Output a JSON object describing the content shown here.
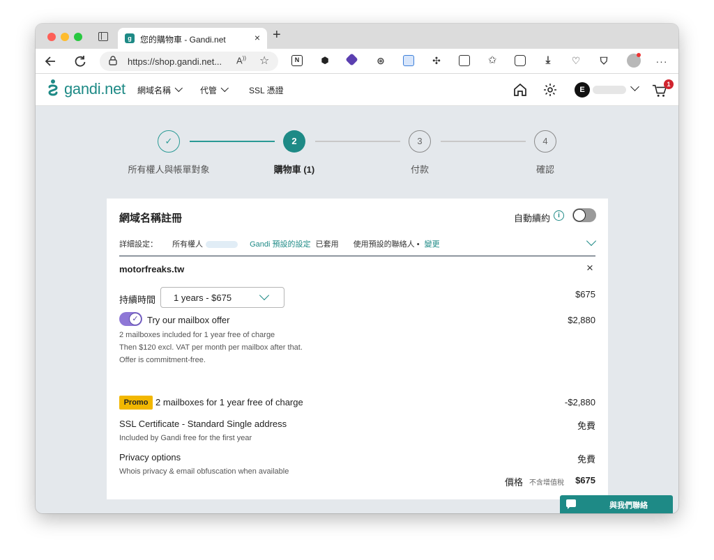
{
  "browser": {
    "tab_title": "您的購物車 - Gandi.net",
    "url": "https://shop.gandi.net...",
    "read_aloud": "Aઇ",
    "new_tab_label": "+"
  },
  "site": {
    "logo_text": "gandi.net",
    "nav": [
      {
        "label": "網域名稱"
      },
      {
        "label": "代管"
      },
      {
        "label": "SSL 憑證"
      }
    ],
    "user_initial": "E",
    "cart_count": "1"
  },
  "stepper": {
    "steps": [
      {
        "label": "所有權人與帳單對象",
        "number": "✓",
        "state": "done"
      },
      {
        "label": "購物車 (1)",
        "number": "2",
        "state": "active"
      },
      {
        "label": "付款",
        "number": "3",
        "state": "pending"
      },
      {
        "label": "確認",
        "number": "4",
        "state": "pending"
      }
    ]
  },
  "card": {
    "title": "網域名稱註冊",
    "auto_renew_label": "自動續約",
    "info_icon": "i",
    "details": {
      "label": "詳細設定：",
      "owner_label": "所有權人",
      "gandi_settings": "Gandi 預設的設定",
      "applied": "已套用",
      "contacts_label": "使用預設的聯絡人 •",
      "change_link": "變更"
    },
    "domain": "motorfreaks.tw",
    "remove_label": "×",
    "duration": {
      "label": "持續時間",
      "selected": "1 years - $675",
      "price": "$675"
    },
    "mailbox": {
      "label": "Try our mailbox offer",
      "price": "$2,880",
      "desc1": "2 mailboxes included for 1 year free of charge",
      "desc2": "Then $120 excl. VAT per month per mailbox after that.",
      "desc3": "Offer is commitment-free.",
      "toggle_check": "✓"
    },
    "promo": {
      "badge": "Promo",
      "label": "2 mailboxes for 1 year free of charge",
      "price": "-$2,880"
    },
    "ssl": {
      "label": "SSL Certificate - Standard Single address",
      "price": "免費",
      "desc": "Included by Gandi free for the first year"
    },
    "privacy": {
      "label": "Privacy options",
      "price": "免費",
      "desc": "Whois privacy & email obfuscation when available"
    },
    "total": {
      "label": "價格",
      "note": "不含增值稅",
      "price": "$675"
    }
  },
  "contact_button": {
    "label": "與我們聯絡"
  },
  "colors": {
    "brand": "#1e8a86",
    "promo": "#f2b701",
    "toggle_on": "#8e77d6",
    "cart_badge": "#d0252f"
  },
  "icons": [
    "back-icon",
    "reload-icon",
    "lock-icon",
    "star-icon",
    "home-icon",
    "gear-icon",
    "cart-icon",
    "chat-icon"
  ]
}
